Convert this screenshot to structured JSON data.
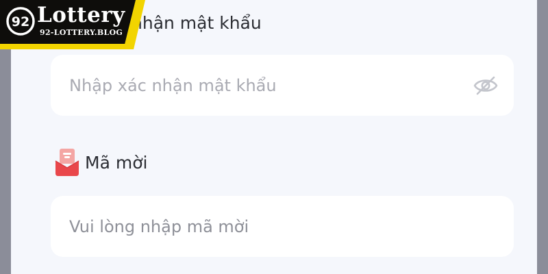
{
  "watermark": {
    "logo_glyph": "92",
    "name": "Lottery",
    "domain": "92-LOTTERY.BLOG",
    "colors": {
      "frame": "#f2d400",
      "background": "#0e0d0b",
      "text": "#ffffff"
    }
  },
  "form": {
    "confirm_password": {
      "label": "Xác nhận mật khẩu",
      "label_visible": "nhận mật khẩu",
      "placeholder": "Nhập xác nhận mật khẩu",
      "value": "",
      "toggle_icon": "eye-off-icon"
    },
    "invite_code": {
      "label": "Mã mời",
      "label_icon": "gift-box-icon",
      "placeholder": "Vui lòng nhập mã mời",
      "value": ""
    }
  },
  "colors": {
    "page_background": "#f5f7fc",
    "input_background": "#ffffff",
    "label_text": "#2b2d33",
    "placeholder_text": "#a9aab2",
    "icon_red": "#e9474b",
    "side_gutter": "#8b8d99"
  }
}
